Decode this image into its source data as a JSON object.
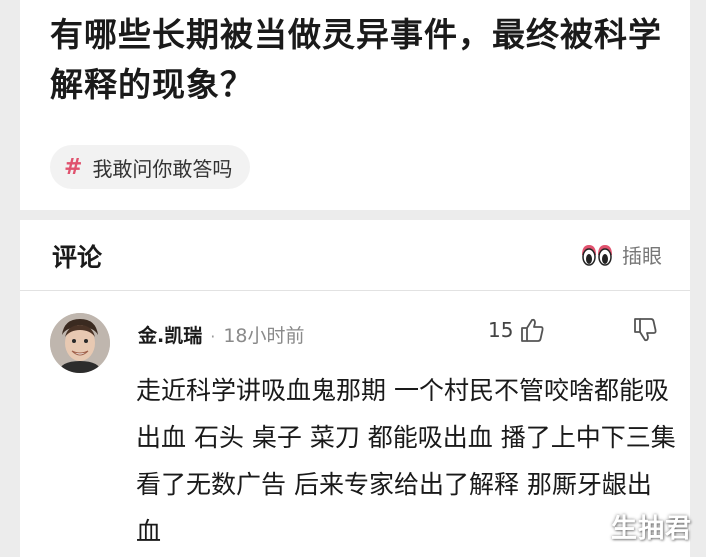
{
  "question": {
    "title": "有哪些长期被当做灵异事件，最终被科学解释的现象？",
    "topic": "我敢问你敢答吗"
  },
  "comments_section": {
    "title": "评论",
    "peek_label": "插眼"
  },
  "comment": {
    "username": "金.凯瑞",
    "separator": "·",
    "time": "18小时前",
    "like_count": "15",
    "body": "走近科学讲吸血鬼那期  一个村民不管咬啥都能吸出血  石头  桌子  菜刀  都能吸出血  播了上中下三集  看了无数广告  后来专家给出了解释  那厮牙龈出血"
  },
  "watermark": "生抽君",
  "colors": {
    "accent": "#e0526e",
    "card": "#ffffff",
    "background": "#ececec"
  }
}
